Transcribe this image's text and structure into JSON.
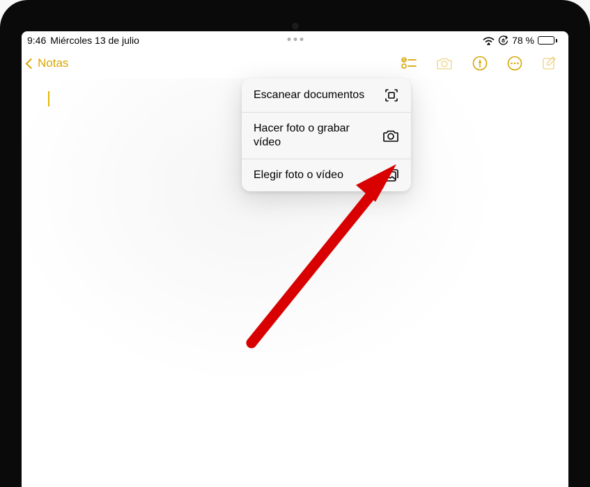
{
  "status_bar": {
    "time": "9:46",
    "date": "Miércoles 13 de julio",
    "battery_percent": "78 %"
  },
  "nav": {
    "back_label": "Notas"
  },
  "popup": {
    "items": [
      {
        "label": "Escanear documentos"
      },
      {
        "label": "Hacer foto o grabar vídeo"
      },
      {
        "label": "Elegir foto o vídeo"
      }
    ]
  },
  "colors": {
    "accent": "#d6a500",
    "annotation": "#e00000"
  }
}
